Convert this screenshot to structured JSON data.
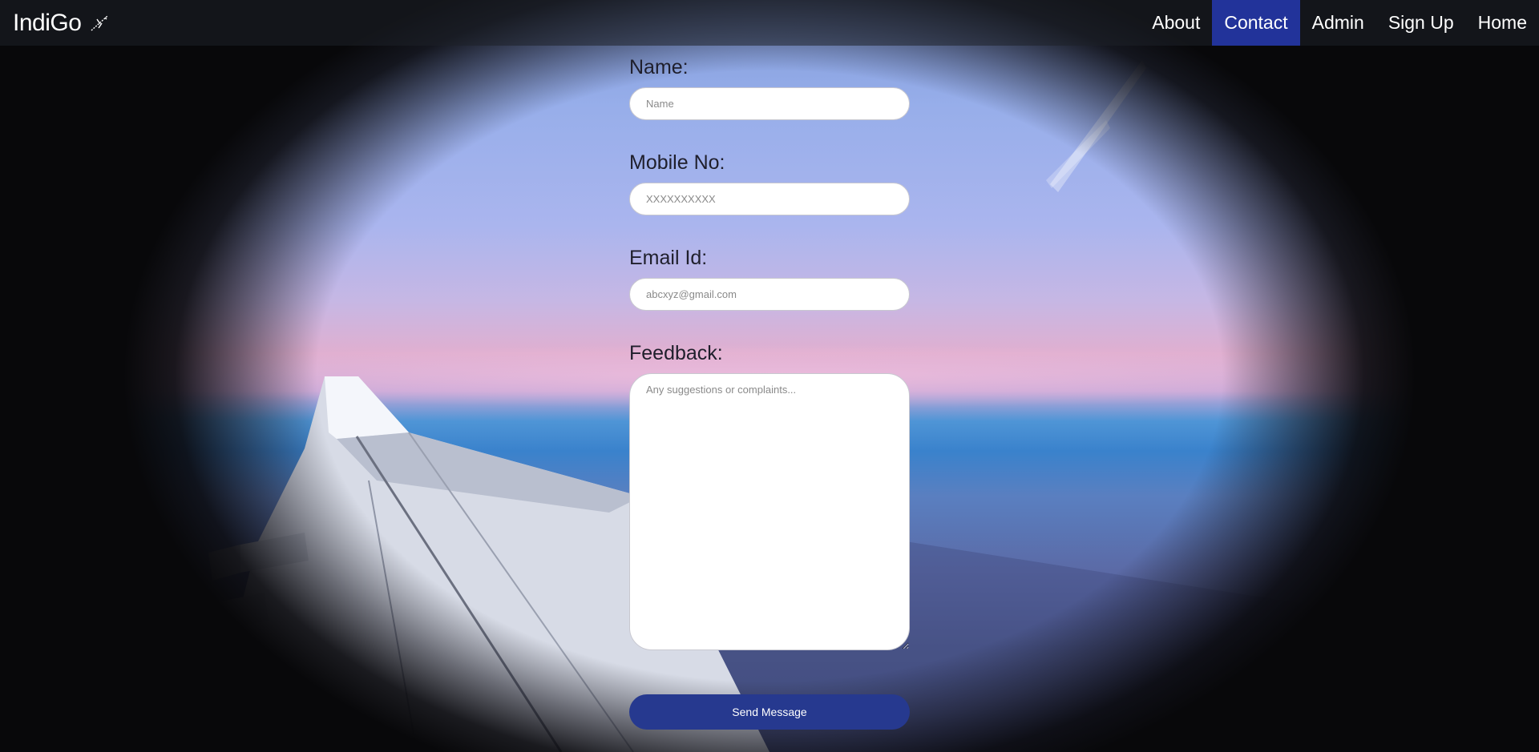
{
  "navbar": {
    "brand": "IndiGo",
    "brand_icon": "airplane-icon",
    "links": [
      {
        "label": "About",
        "active": false
      },
      {
        "label": "Contact",
        "active": true
      },
      {
        "label": "Admin",
        "active": false
      },
      {
        "label": "Sign Up",
        "active": false
      },
      {
        "label": "Home",
        "active": false
      }
    ],
    "active_color": "#22339a"
  },
  "form": {
    "name": {
      "label": "Name:",
      "placeholder": "Name",
      "value": ""
    },
    "mobile": {
      "label": "Mobile No:",
      "placeholder": "XXXXXXXXXX",
      "value": ""
    },
    "email": {
      "label": "Email Id:",
      "placeholder": "abcxyz@gmail.com",
      "value": ""
    },
    "feedback": {
      "label": "Feedback:",
      "placeholder": "Any suggestions or complaints...",
      "value": ""
    },
    "submit_label": "Send Message",
    "submit_color": "#26398f"
  }
}
